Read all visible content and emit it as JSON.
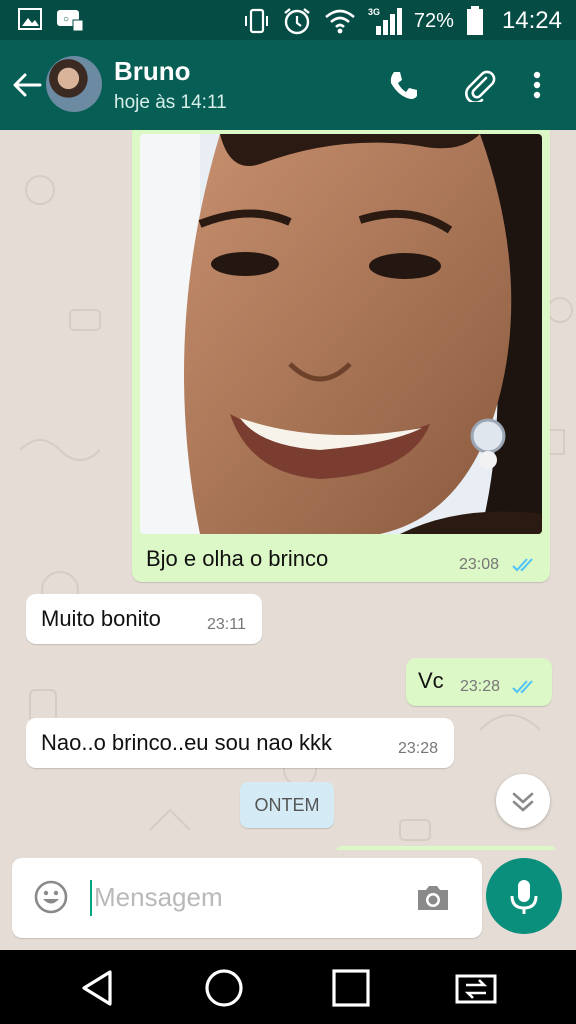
{
  "status_bar": {
    "battery": "72%",
    "time": "14:24",
    "icons": [
      "image-icon",
      "notification-icon",
      "vibrate-icon",
      "alarm-icon",
      "wifi-icon",
      "signal-3g-icon",
      "battery-icon"
    ]
  },
  "header": {
    "contact_name": "Bruno",
    "last_seen": "hoje às 14:11",
    "icons": [
      "back-arrow-icon",
      "avatar",
      "phone-icon",
      "attach-icon",
      "more-vert-icon"
    ]
  },
  "messages": [
    {
      "direction": "out",
      "type": "image",
      "caption": "Bjo e olha o brinco",
      "time": "23:08",
      "read": true
    },
    {
      "direction": "in",
      "text": "Muito bonito",
      "time": "23:11"
    },
    {
      "direction": "out",
      "text": "Vc",
      "time": "23:28",
      "read": true
    },
    {
      "direction": "in",
      "text": "Nao..o brinco..eu sou nao kkk",
      "time": "23:28"
    }
  ],
  "date_separator": "ONTEM",
  "composer": {
    "placeholder": "Mensagem"
  },
  "colors": {
    "status_bar": "#054d44",
    "app_bar": "#075e54",
    "outgoing_bubble": "#dcf8c6",
    "incoming_bubble": "#ffffff",
    "chat_bg": "#e5ddd5",
    "accent": "#0b8f7d",
    "read_ticks": "#4fc3f7"
  }
}
